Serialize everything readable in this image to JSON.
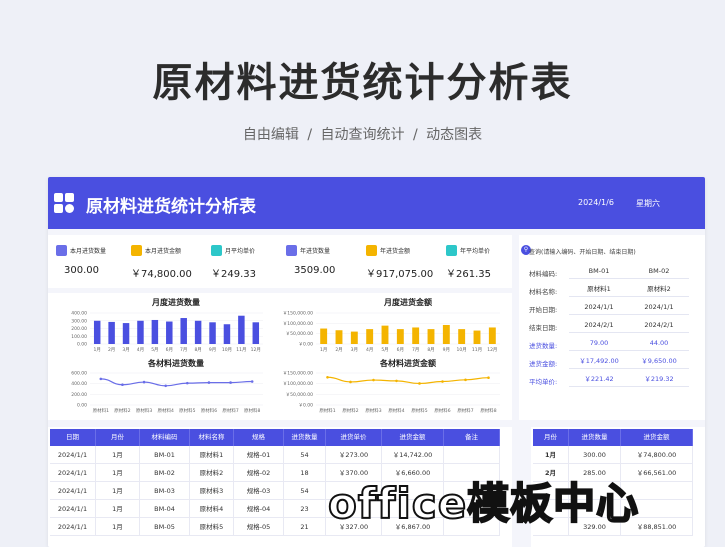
{
  "hero": {
    "title": "原材料进货统计分析表",
    "subtitle_parts": [
      "自由编辑",
      "/",
      "自动查询统计",
      "/",
      "动态图表"
    ]
  },
  "topbar": {
    "title": "原材料进货统计分析表",
    "date": "2024/1/6",
    "weekday": "星期六",
    "accent": "#4a4fe0"
  },
  "kpis": [
    {
      "label": "本月进货数量",
      "value": "300.00",
      "icon": "box-icon",
      "color": "#6a6ee8"
    },
    {
      "label": "本月进货金额",
      "value": "￥74,800.00",
      "icon": "money-icon",
      "color": "#f4b400"
    },
    {
      "label": "月平均单价",
      "value": "￥249.33",
      "icon": "price-icon",
      "color": "#2dc7c9"
    },
    {
      "label": "年进货数量",
      "value": "3509.00",
      "icon": "box-icon",
      "color": "#6a6ee8"
    },
    {
      "label": "年进货金额",
      "value": "￥917,075.00",
      "icon": "money-icon",
      "color": "#f4b400"
    },
    {
      "label": "年平均单价",
      "value": "￥261.35",
      "icon": "price-icon",
      "color": "#2dc7c9"
    }
  ],
  "chart_data": [
    {
      "type": "bar",
      "title": "月度进货数量",
      "categories": [
        "1月",
        "2月",
        "3月",
        "4月",
        "5月",
        "6月",
        "7月",
        "8月",
        "9月",
        "10月",
        "11月",
        "12月"
      ],
      "values": [
        300,
        285,
        270,
        300,
        310,
        290,
        335,
        300,
        280,
        255,
        365,
        280
      ],
      "ylim": [
        0,
        400
      ],
      "yticks": [
        "400.00",
        "300.00",
        "200.00",
        "100.00",
        "0.00"
      ],
      "color": "#4a4fe0"
    },
    {
      "type": "bar",
      "title": "月度进货金额",
      "categories": [
        "1月",
        "2月",
        "3月",
        "4月",
        "5月",
        "6月",
        "7月",
        "8月",
        "9月",
        "10月",
        "11月",
        "12月"
      ],
      "values": [
        74800,
        66561,
        60000,
        72000,
        88851,
        72000,
        80000,
        72000,
        92000,
        72000,
        65000,
        80000
      ],
      "ylim": [
        0,
        150000
      ],
      "yticks": [
        "￥150,000.00",
        "￥100,000.00",
        "￥50,000.00",
        "￥0.00"
      ],
      "color": "#f4b400"
    },
    {
      "type": "line",
      "title": "各材料进货数量",
      "categories": [
        "原材料1",
        "原材料2",
        "原材料3",
        "原材料4",
        "原材料5",
        "原材料6",
        "原材料7",
        "原材料8"
      ],
      "values": [
        490,
        380,
        430,
        360,
        410,
        420,
        420,
        440
      ],
      "ylim": [
        0,
        600
      ],
      "yticks": [
        "600.00",
        "400.00",
        "200.00",
        "0.00"
      ],
      "color": "#6a6ee8"
    },
    {
      "type": "line",
      "title": "各材料进货金额",
      "categories": [
        "原材料1",
        "原材料2",
        "原材料3",
        "原材料4",
        "原材料5",
        "原材料6",
        "原材料7",
        "原材料8"
      ],
      "values": [
        130000,
        108000,
        117000,
        113000,
        101000,
        110000,
        118000,
        128000
      ],
      "ylim": [
        0,
        150000
      ],
      "yticks": [
        "￥150,000.00",
        "￥100,000.00",
        "￥50,000.00",
        "￥0.00"
      ],
      "color": "#f4b400"
    }
  ],
  "query": {
    "title": "查询(请输入编码、开始日期、结束日期)",
    "rows": [
      {
        "key": "材料编码:",
        "a": "BM-01",
        "b": "BM-02",
        "hl": false
      },
      {
        "key": "材料名称:",
        "a": "原材料1",
        "b": "原材料2",
        "hl": false
      },
      {
        "key": "开始日期:",
        "a": "2024/1/1",
        "b": "2024/1/1",
        "hl": false
      },
      {
        "key": "结束日期:",
        "a": "2024/2/1",
        "b": "2024/2/1",
        "hl": false
      },
      {
        "key": "进货数量:",
        "a": "79.00",
        "b": "44.00",
        "hl": true
      },
      {
        "key": "进货金额:",
        "a": "￥17,492.00",
        "b": "￥9,650.00",
        "hl": true
      },
      {
        "key": "平均单价:",
        "a": "￥221.42",
        "b": "￥219.32",
        "hl": true
      }
    ]
  },
  "table": {
    "headers": [
      "日期",
      "月份",
      "材料编码",
      "材料名称",
      "规格",
      "进货数量",
      "进货单价",
      "进货金额",
      "备注"
    ],
    "rows": [
      [
        "2024/1/1",
        "1月",
        "BM-01",
        "原材料1",
        "规格-01",
        "54",
        "￥273.00",
        "￥14,742.00",
        ""
      ],
      [
        "2024/1/1",
        "1月",
        "BM-02",
        "原材料2",
        "规格-02",
        "18",
        "￥370.00",
        "￥6,660.00",
        ""
      ],
      [
        "2024/1/1",
        "1月",
        "BM-03",
        "原材料3",
        "规格-03",
        "54",
        "",
        "",
        " "
      ],
      [
        "2024/1/1",
        "1月",
        "BM-04",
        "原材料4",
        "规格-04",
        "23",
        "",
        "",
        " "
      ],
      [
        "2024/1/1",
        "1月",
        "BM-05",
        "原材料5",
        "规格-05",
        "21",
        "￥327.00",
        "￥6,867.00",
        ""
      ]
    ]
  },
  "mini_table": {
    "headers": [
      "月份",
      "进货数量",
      "进货金额"
    ],
    "rows": [
      [
        "1月",
        "300.00",
        "￥74,800.00"
      ],
      [
        "2月",
        "285.00",
        "￥66,561.00"
      ],
      [
        "",
        "",
        ""
      ],
      [
        "",
        "",
        ""
      ],
      [
        "",
        "329.00",
        "￥88,851.00"
      ]
    ]
  },
  "watermark": "office模板中心"
}
